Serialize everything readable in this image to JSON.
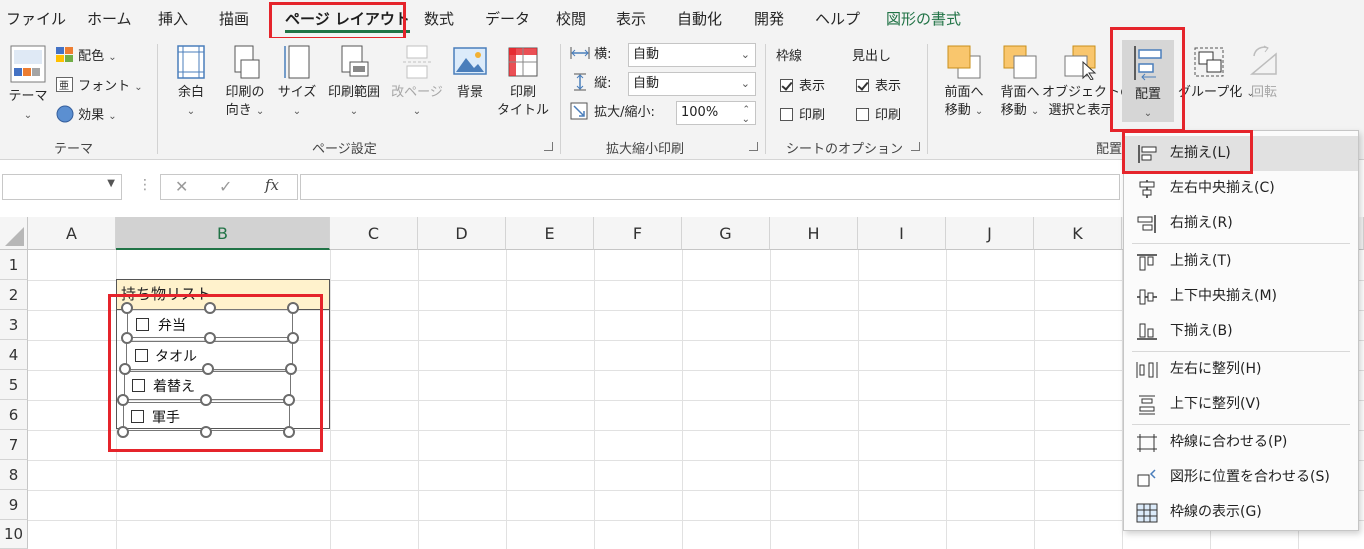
{
  "tabs": [
    "ファイル",
    "ホーム",
    "挿入",
    "描画",
    "ページ レイアウト",
    "数式",
    "データ",
    "校閲",
    "表示",
    "自動化",
    "開発",
    "ヘルプ",
    "図形の書式"
  ],
  "ribbon": {
    "theme": {
      "themes": "テーマ",
      "colors": "配色",
      "fonts": "フォント",
      "effects": "効果",
      "group": "テーマ"
    },
    "page_setup": {
      "margins": "余白",
      "orientation_1": "印刷の",
      "orientation_2": "向き",
      "size": "サイズ",
      "print_area": "印刷範囲",
      "breaks": "改ページ",
      "background": "背景",
      "print_titles_1": "印刷",
      "print_titles_2": "タイトル",
      "group": "ページ設定"
    },
    "scale": {
      "width_label": "横:",
      "width_value": "自動",
      "height_label": "縦:",
      "height_value": "自動",
      "scale_label": "拡大/縮小:",
      "scale_value": "100%",
      "group": "拡大縮小印刷"
    },
    "sheet_options": {
      "gridlines": "枠線",
      "headings": "見出し",
      "view": "表示",
      "print": "印刷",
      "group": "シートのオプション"
    },
    "arrange": {
      "bring_forward_1": "前面へ",
      "bring_forward_2": "移動",
      "send_backward_1": "背面へ",
      "send_backward_2": "移動",
      "selection_pane_1": "オブジェクトの",
      "selection_pane_2": "選択と表示",
      "align": "配置",
      "group_btn": "グループ化",
      "rotate": "回転",
      "group": "配置"
    }
  },
  "formula_bar": {
    "cancel": "✕",
    "enter": "✓",
    "fx": "fx"
  },
  "columns": [
    "A",
    "B",
    "C",
    "D",
    "E",
    "F",
    "G",
    "H",
    "I",
    "J",
    "K"
  ],
  "rows": [
    "1",
    "2",
    "3",
    "4",
    "5",
    "6",
    "7",
    "8",
    "9",
    "10"
  ],
  "sheet": {
    "title": "持ち物リスト",
    "checkboxes": [
      "弁当",
      "タオル",
      "着替え",
      "軍手"
    ]
  },
  "align_menu": {
    "items": [
      "左揃え(L)",
      "左右中央揃え(C)",
      "右揃え(R)",
      "上揃え(T)",
      "上下中央揃え(M)",
      "下揃え(B)",
      "左右に整列(H)",
      "上下に整列(V)",
      "枠線に合わせる(P)",
      "図形に位置を合わせる(S)",
      "枠線の表示(G)"
    ]
  },
  "colors": {
    "accent": "#217346",
    "highlight": "#e5242b",
    "title_fill": "#fff2cc"
  }
}
